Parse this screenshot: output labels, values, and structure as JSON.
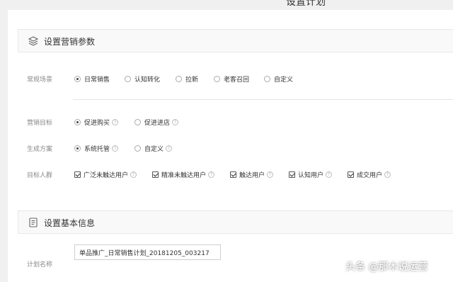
{
  "header": {
    "title": "设置计划"
  },
  "marketing": {
    "title": "设置营销参数",
    "scene": {
      "label": "常规场景",
      "options": [
        "日常销售",
        "认知转化",
        "拉新",
        "老客召回",
        "自定义"
      ]
    },
    "goal": {
      "label": "营销目标",
      "options": [
        "促进购买",
        "促进进店"
      ]
    },
    "plan": {
      "label": "生成方案",
      "options": [
        "系统托管",
        "自定义"
      ]
    },
    "audience": {
      "label": "目标人群",
      "options": [
        "广泛未触达用户",
        "精准未触达用户",
        "触达用户",
        "认知用户",
        "成交用户"
      ]
    }
  },
  "basic": {
    "title": "设置基本信息",
    "name_label": "计划名称",
    "name_value": "单品推广_日常销售计划_20181205_003217"
  },
  "watermark": "头条 @那木说运营",
  "icons": {
    "help": "?"
  }
}
